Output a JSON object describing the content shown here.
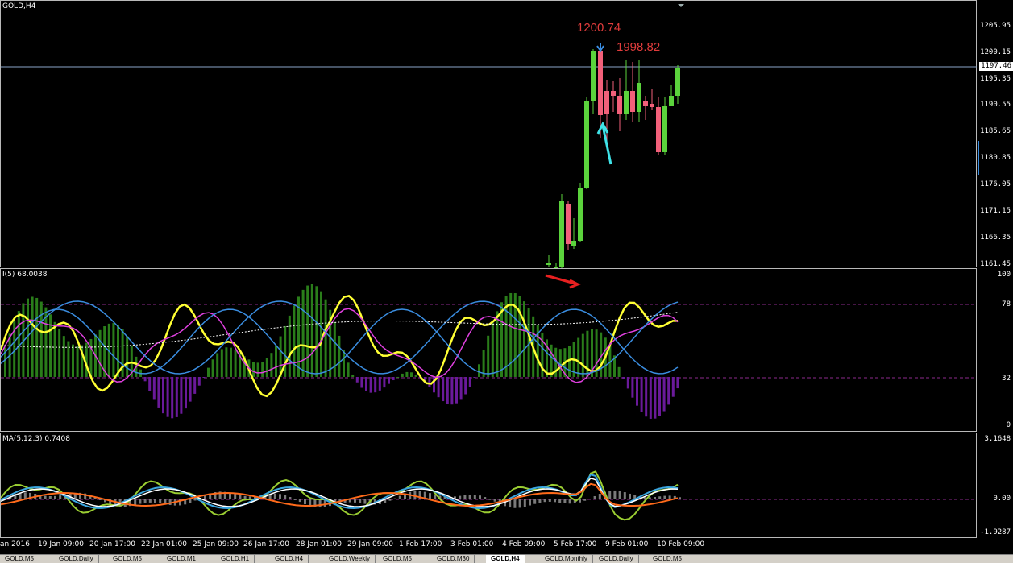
{
  "chart": {
    "symbol_label": "GOLD,H4",
    "current_price": "1197.46",
    "annotation_high": "1200.74",
    "annotation_second": "1998.82",
    "price_ticks": [
      "1205.95",
      "1200.15",
      "1195.35",
      "1190.55",
      "1185.65",
      "1180.85",
      "1176.05",
      "1171.15",
      "1166.35",
      "1161.45"
    ],
    "bull_color": "#5bd33c",
    "bear_color": "#f2607a"
  },
  "rsi_panel": {
    "label": "I(5) 68.0038",
    "ticks": [
      "100",
      "78",
      "32",
      "0"
    ]
  },
  "macd_panel": {
    "label": "MA(5,12,3) 0.7408",
    "ticks": [
      "3.1648",
      "0.00",
      "-1.9287"
    ]
  },
  "time_axis": [
    "an 2016",
    "19 Jan 09:00",
    "20 Jan 17:00",
    "22 Jan 01:00",
    "25 Jan 09:00",
    "26 Jan 17:00",
    "28 Jan 01:00",
    "29 Jan 09:00",
    "1 Feb 17:00",
    "3 Feb 01:00",
    "4 Feb 09:00",
    "5 Feb 17:00",
    "9 Feb 01:00",
    "10 Feb 09:00"
  ],
  "tabs": [
    "GOLD,M5",
    "GOLD,Daily",
    "GOLD,M5",
    "GOLD,M1",
    "GOLD,H1",
    "GOLD,H4",
    "GOLD,Weekly",
    "GOLD,M5",
    "GOLD,M30",
    "GOLD,H4",
    "GOLD,Monthly",
    "GOLD,Daily",
    "GOLD,M5"
  ],
  "active_tab_index": 9
}
